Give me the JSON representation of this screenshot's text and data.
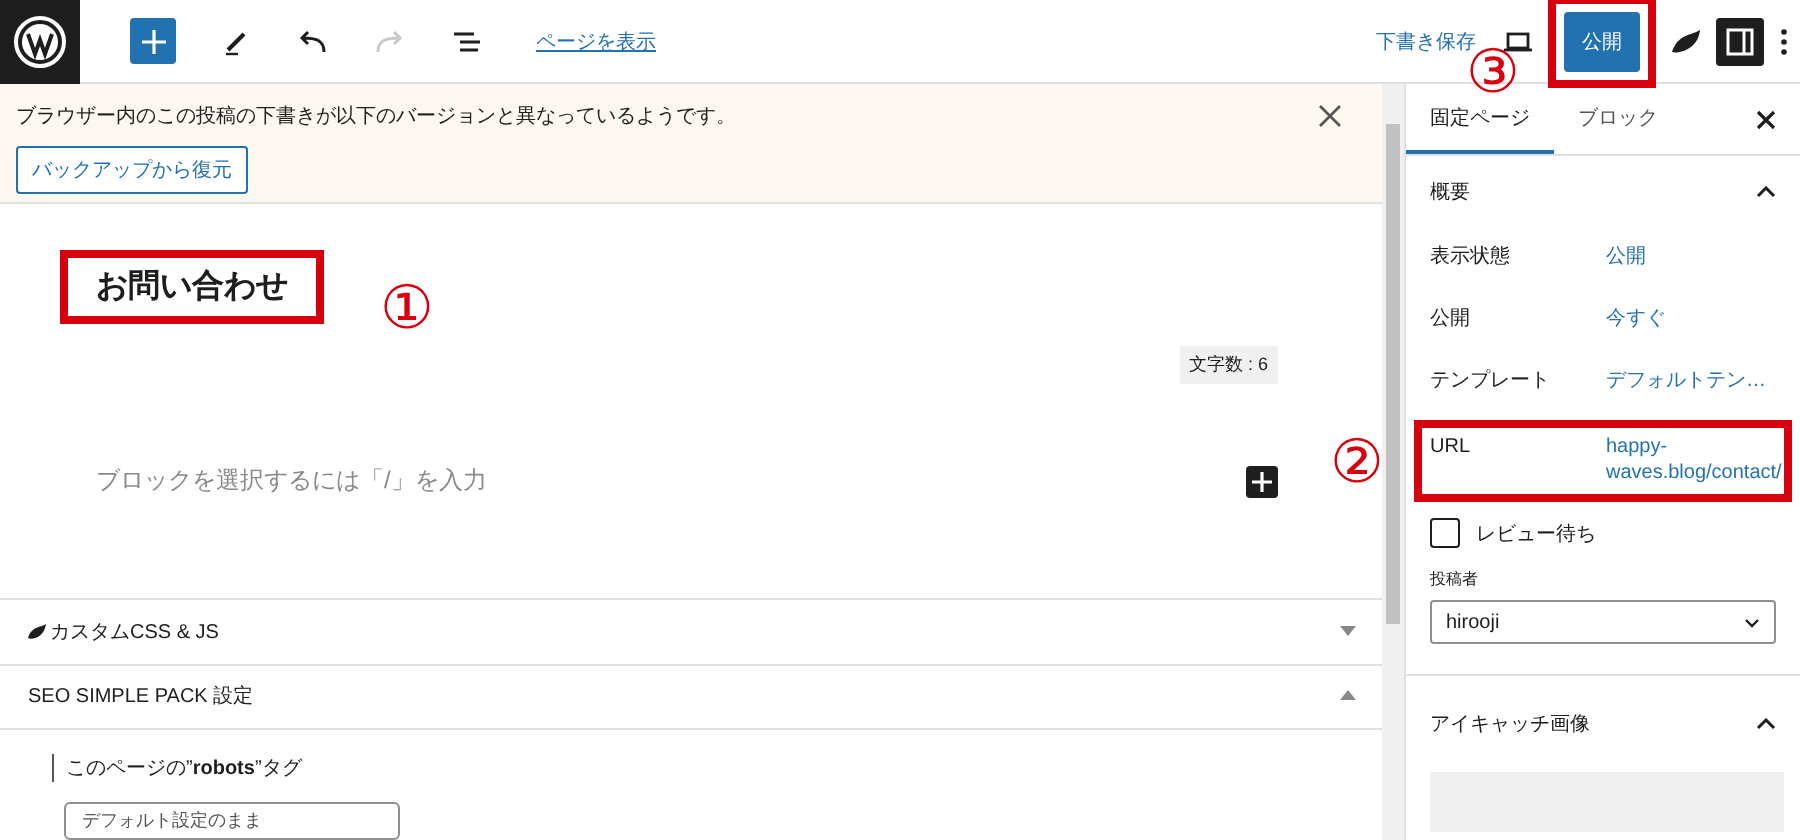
{
  "toolbar": {
    "view_link": "ページを表示",
    "save_draft": "下書き保存",
    "publish": "公開",
    "publish_highlighted": true
  },
  "notice": {
    "message": "ブラウザー内のこの投稿の下書きが以下のバージョンと異なっているようです。",
    "button": "バックアップから復元"
  },
  "editor": {
    "title": "お問い合わせ",
    "title_highlighted": true,
    "char_count": "文字数 : 6",
    "placeholder": "ブロックを選択するには「/」を入力"
  },
  "meta_panels": [
    {
      "kind": "css",
      "title": "カスタムCSS & JS",
      "expanded": false
    },
    {
      "kind": "plain",
      "title": "SEO SIMPLE PACK 設定",
      "expanded": true
    }
  ],
  "seo": {
    "robots_label": "このページの”**robots**”タグ",
    "select_value": "デフォルト設定のまま"
  },
  "sidebar": {
    "tabs": [
      {
        "label": "固定ページ",
        "selected": true
      },
      {
        "label": "ブロック",
        "selected": false
      }
    ],
    "summary": {
      "title": "概要",
      "expanded": true
    },
    "rows": [
      {
        "label": "表示状態",
        "value": "公開",
        "highlighted": false
      },
      {
        "label": "公開",
        "value": "今すぐ",
        "highlighted": false
      },
      {
        "label": "テンプレート",
        "value": "デフォルトテン…",
        "highlighted": false
      },
      {
        "label": "URL",
        "value": "happy-waves.blog/contact/",
        "highlighted": true
      }
    ],
    "review": {
      "label": "レビュー待ち",
      "checked": false
    },
    "author": {
      "label": "投稿者",
      "value": "hirooji"
    },
    "featured": {
      "title": "アイキャッチ画像",
      "expanded": true
    }
  },
  "annotations": [
    "①",
    "②",
    "③"
  ]
}
